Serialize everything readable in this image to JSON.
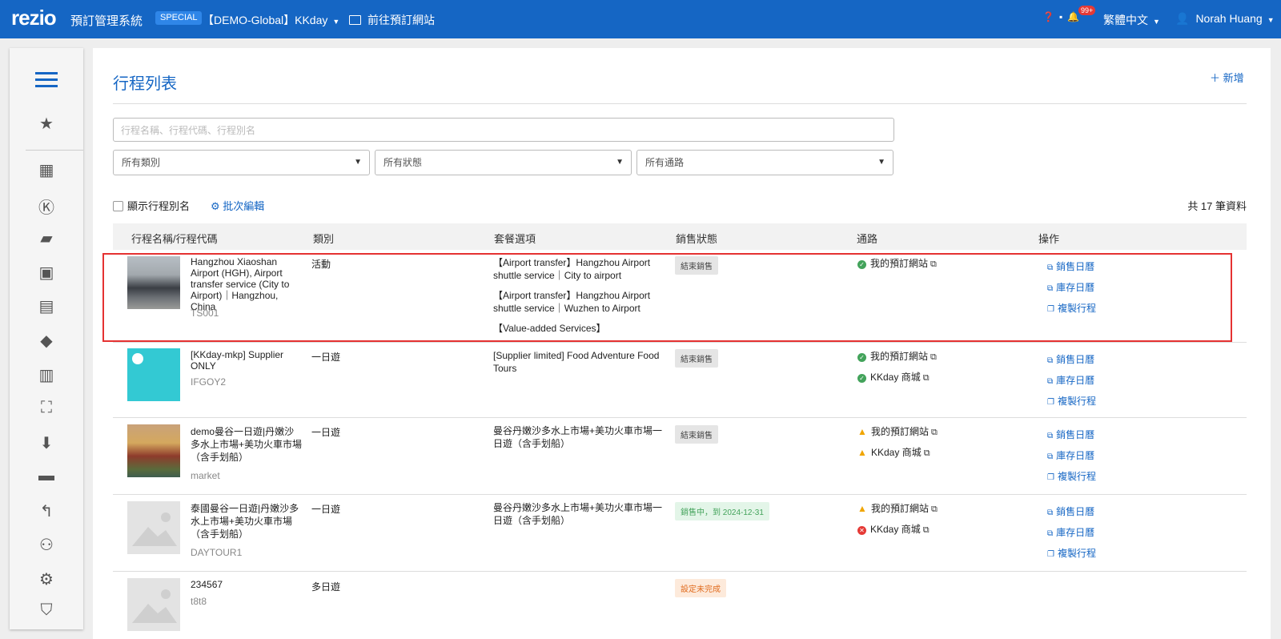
{
  "topbar": {
    "logo": "rezio",
    "system_name": "預訂管理系統",
    "badge": "SPECIAL",
    "company": "【DEMO-Global】KKday",
    "goto": "前往預訂網站",
    "notif_count": "99+",
    "language": "繁體中文",
    "user": "Norah Huang"
  },
  "page": {
    "title": "行程列表",
    "add_label": "＋ 新增",
    "search_placeholder": "行程名稱、行程代碼、行程別名",
    "filters": [
      "所有類別",
      "所有狀態",
      "所有通路"
    ],
    "show_alias": "顯示行程別名",
    "batch_edit": "批次編輯",
    "total": "共 17 筆資料"
  },
  "table": {
    "headers": [
      "行程名稱/行程代碼",
      "類別",
      "套餐選項",
      "銷售狀態",
      "通路",
      "操作"
    ],
    "actions": [
      "銷售日曆",
      "庫存日曆",
      "複製行程"
    ],
    "rows": [
      {
        "name": "Hangzhou Xiaoshan Airport (HGH), Airport transfer service (City to Airport)｜Hangzhou, China",
        "code": "TS001",
        "category": "活動",
        "packages": [
          "【Airport transfer】Hangzhou Airport shuttle service｜City to airport",
          "【Airport transfer】Hangzhou Airport shuttle service｜Wuzhen to Airport",
          "【Value-added Services】"
        ],
        "status": "結束銷售",
        "channels": [
          {
            "name": "我的預訂網站",
            "state": "ok"
          }
        ]
      },
      {
        "name": "[KKday-mkp] Supplier ONLY",
        "code": "IFGOY2",
        "category": "一日遊",
        "packages": [
          "[Supplier limited] Food Adventure Food Tours"
        ],
        "status": "結束銷售",
        "channels": [
          {
            "name": "我的預訂網站",
            "state": "ok"
          },
          {
            "name": "KKday 商城",
            "state": "ok"
          }
        ]
      },
      {
        "name": "demo曼谷一日遊|丹嫩沙多水上市場+美功火車市場（含手划船）",
        "code": "market",
        "category": "一日遊",
        "packages": [
          "曼谷丹嫩沙多水上市場+美功火車市場一日遊（含手划船）"
        ],
        "status": "結束銷售",
        "channels": [
          {
            "name": "我的預訂網站",
            "state": "warn"
          },
          {
            "name": "KKday 商城",
            "state": "warn"
          }
        ]
      },
      {
        "name": "泰國曼谷一日遊|丹嫩沙多水上市場+美功火車市場（含手划船）",
        "code": "DAYTOUR1",
        "category": "一日遊",
        "packages": [
          "曼谷丹嫩沙多水上市場+美功火車市場一日遊（含手划船）"
        ],
        "status": "銷售中，到 2024-12-31",
        "channels": [
          {
            "name": "我的預訂網站",
            "state": "warn"
          },
          {
            "name": "KKday 商城",
            "state": "err"
          }
        ]
      },
      {
        "name": "234567",
        "code": "t8t8",
        "category": "多日遊",
        "packages": [],
        "status": "設定未完成",
        "channels": []
      }
    ]
  },
  "colors": {
    "primary": "#1566c4",
    "highlight": "#e53232"
  }
}
